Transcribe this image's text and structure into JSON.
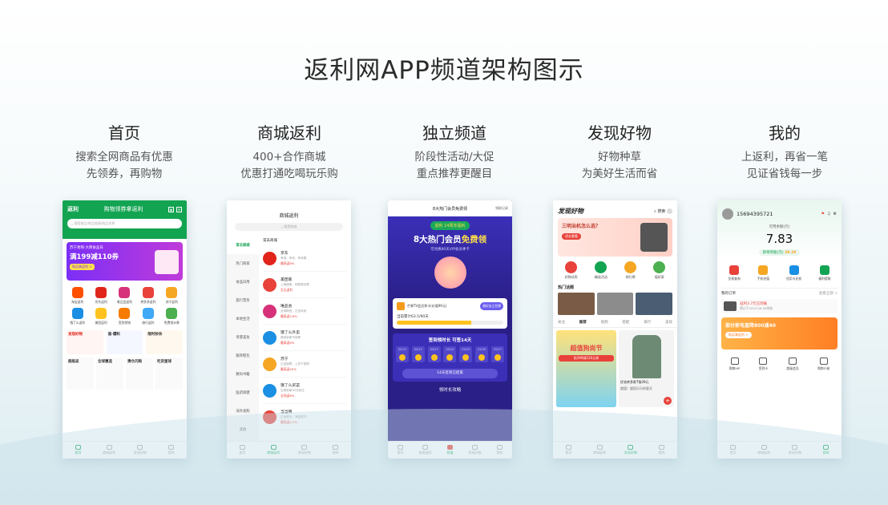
{
  "title": "返利网APP频道架构图示",
  "columns": [
    {
      "title": "首页",
      "desc1": "搜索全网商品有优惠",
      "desc2": "先领券，再购物"
    },
    {
      "title": "商城返利",
      "desc1": "400+合作商城",
      "desc2": "优惠打通吃喝玩乐购"
    },
    {
      "title": "独立频道",
      "desc1": "阶段性活动/大促",
      "desc2": "重点推荐更醒目"
    },
    {
      "title": "发现好物",
      "desc1": "好物种草",
      "desc2": "为美好生活而省"
    },
    {
      "title": "我的",
      "desc1": "上返利，再省一笔",
      "desc2": "见证省钱每一步"
    }
  ],
  "home": {
    "logo": "返利",
    "header": "购物领券拿返利",
    "search_placeholder": "搜索商品/商品链接/商品名称",
    "banner_line1": "苏宁易购·大牌食品日",
    "banner_line2": "满199减110券",
    "banner_btn": "购买拿返利 >",
    "grid": [
      "淘宝返利",
      "京东返利",
      "唯品会返利",
      "拼多多返利",
      "苏宁返利",
      "饿了么返利",
      "美团返利",
      "签到领钱",
      "旅行返利",
      "免费领水果"
    ],
    "promo": [
      "发现好物",
      "值·爆料",
      "限时秒杀"
    ],
    "promo2": [
      "超级返",
      "全球惠选",
      "清仓闪购",
      "吃货星球"
    ],
    "tabs": [
      "首页",
      "商城返利",
      "发现好物",
      "我的"
    ]
  },
  "mall": {
    "header": "商城返利",
    "search": "搜索商城",
    "cats": [
      "常去商城",
      "热门商家",
      "食品日用",
      "旅行票务",
      "本地生活",
      "母婴美妆",
      "服饰鞋包",
      "数码书籍",
      "医药保健",
      "海外直购",
      "其他"
    ],
    "sub": "常去商城",
    "shops": [
      {
        "name": "京东",
        "sub": "有我，有你，有惊喜",
        "rate": "最高返8%",
        "color": "#e1251b"
      },
      {
        "name": "美团家",
        "sub": "上美团家，购物更划算",
        "rate": "至无返利",
        "color": "#e8423a"
      },
      {
        "name": "唯品会",
        "sub": "全球精选，正品特卖",
        "rate": "最高返5.6%",
        "color": "#d6317a"
      },
      {
        "name": "饿了么外卖",
        "sub": "美味到家不用等",
        "rate": "最高返8%",
        "color": "#1a8fe3"
      },
      {
        "name": "苏宁",
        "sub": "正品保障，上苏宁易购",
        "rate": "最高返40%",
        "color": "#f5a623"
      },
      {
        "name": "饿了么买菜",
        "sub": "生鲜到家30分钟达",
        "rate": "全场返8%",
        "color": "#1a8fe3"
      },
      {
        "name": "当当网",
        "sub": "正品低价，海量图书",
        "rate": "最高返4.2%",
        "color": "#e8423a"
      }
    ],
    "tabs": [
      "首页",
      "商城返利",
      "发现好物",
      "我的"
    ]
  },
  "channel": {
    "header": "8大热门会员免费领",
    "record": "领取记录",
    "badge": "返利 14周年福利",
    "hero1": "8大热门会员",
    "hero2": "免费领",
    "hero_sub": "可兑换80天VIP会员季卡",
    "card_title": "芒果TV会员季卡(价值99元)",
    "card_btn": "邀好友立兑换",
    "progress": "当前累计63.5/90天",
    "progress_pct": 0.7,
    "signin": "签到领时长 可签14天",
    "days": [
      "05/21",
      "05/22",
      "05/23",
      "05/24",
      "05/25",
      "05/26",
      "05/27"
    ],
    "signed": "14天签到已结束",
    "tips": "领时长攻略",
    "tabs": [
      "首页",
      "商城返利",
      "频道",
      "发现好物",
      "我的"
    ]
  },
  "discover": {
    "logo": "发现好物",
    "search": "搜索",
    "banner1": "三明治机怎么选？",
    "banner_btn": "进去看看",
    "icons": [
      "好物试用",
      "精选活动",
      "排行榜",
      "值好家"
    ],
    "section": "热门话题",
    "tabs": [
      "关注",
      "推荐",
      "视频",
      "搭配",
      "排行",
      "美妆"
    ],
    "card1": "超值狗尚节",
    "card1_sub": "抢399减120元券",
    "card2": "优衣库多款T恤39元",
    "card2_sub": "超值！超搭乐乐的夏天",
    "bottom": [
      "首页",
      "商城返利",
      "发现好物",
      "我的"
    ]
  },
  "mine": {
    "phone": "15694395721",
    "label": "可用余额(元)",
    "amount": "7.83",
    "pending_label": "即将到账(元)",
    "pending": "38.29",
    "icons": [
      "交易查询",
      "手机充值",
      "信用卡还款",
      "福利提取"
    ],
    "orders": "我的订单",
    "orders_more": "查看全部 >",
    "order_text": "返利3.7元已到账",
    "order_time": "预计于2020-06-08到账",
    "ad": "部分家电直降800减40",
    "ad_btn": "购买拿返利 >",
    "grid": [
      "购物VIP",
      "签到卡",
      "超级会员",
      "购物小秘"
    ],
    "tabs": [
      "首页",
      "商城返利",
      "发现好物",
      "我的"
    ]
  }
}
